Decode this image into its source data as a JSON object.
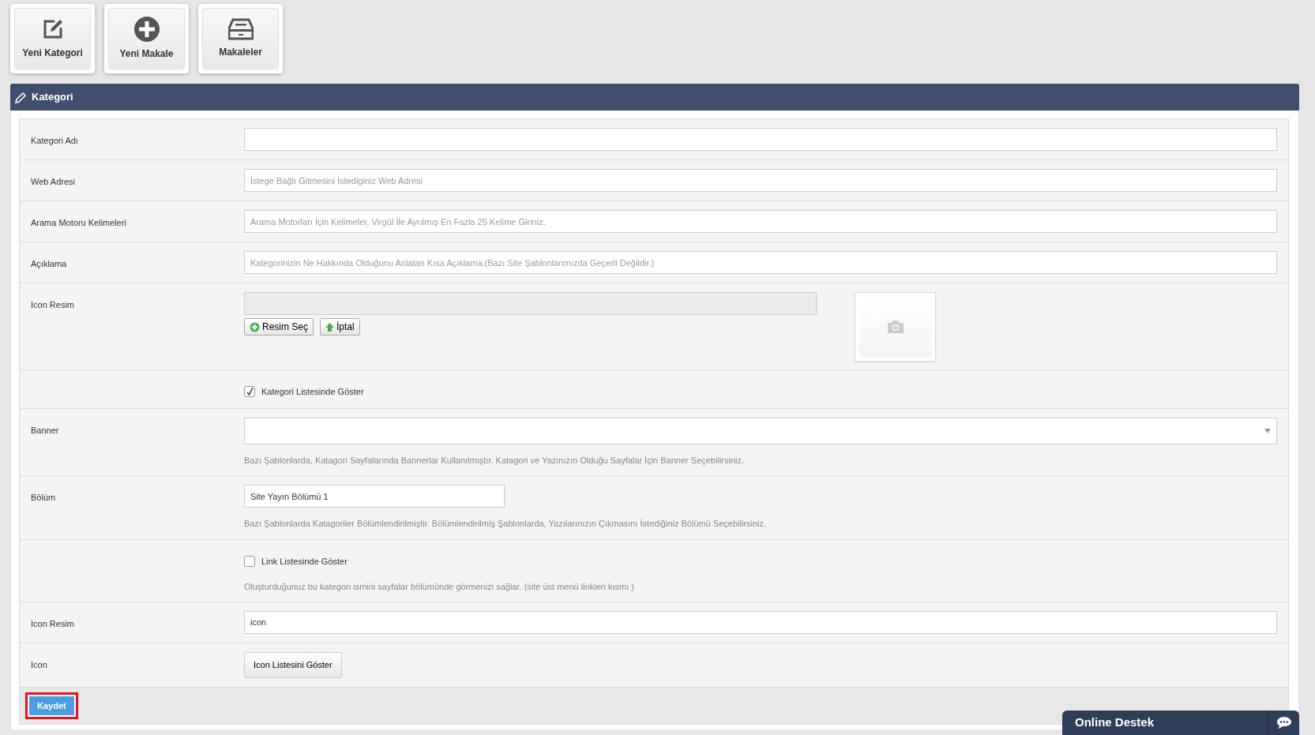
{
  "toolbar": [
    {
      "kind": "edit",
      "label": "Yeni Kategori"
    },
    {
      "kind": "plus",
      "label": "Yeni Makale"
    },
    {
      "kind": "drawer",
      "label": "Makaleler"
    }
  ],
  "panel": {
    "title": "Kategori"
  },
  "rows": [
    {
      "kind": "text",
      "label": "Kategori Adı"
    },
    {
      "kind": "text",
      "label": "Web Adresi",
      "placeholder": "İstege Bağlı Gitmesini İstediginiz Web Adresi"
    },
    {
      "kind": "text",
      "label": "Arama Motoru Kelimeleri",
      "placeholder": "Arama Motorları İçin Kelimeler, Virgül İle Ayrılmış En Fazla 25 Kelime Giriniz."
    },
    {
      "kind": "text",
      "label": "Açıklama",
      "placeholder": "Kategorinizin Ne Hakkında Olduğunu Anlatan Kısa Açıklama.(Bazı Site Şablonlarımızda Geçerli Değildir.)"
    },
    {
      "kind": "upload",
      "label": "Icon Resim",
      "buttons": [
        {
          "kind": "add",
          "label": "Resim Seç"
        },
        {
          "kind": "up",
          "label": "İptal"
        }
      ]
    },
    {
      "kind": "checkbox",
      "text": "Kategori Listesinde Göster",
      "checked": true
    },
    {
      "kind": "combo",
      "label": "Banner",
      "help": "Bazı Şablonlarda, Katagori Sayfalarında Bannerlar Kullanılmıştır. Katagori ve Yazınızın Olduğu Sayfalar İçin Banner Seçebilirsiniz."
    },
    {
      "kind": "select",
      "label": "Bölüm",
      "value": "Site Yayın Bölümü 1",
      "narrow": true,
      "help": "Bazı Şablonlarda Katagoriler Bölümlendirilmiştir. Bölümlendirilmiş Şablonlarda, Yazılarınızın Çıkmasını İstediğiniz Bölümü Seçebilirsiniz."
    },
    {
      "kind": "checkbox",
      "text": "Link Listesinde Göster",
      "checked": false,
      "help": "Oluşturduğunuz bu kategori ismini sayfalar bölümünde görmenizi sağlar. (site üst menü linkleri kısmı )"
    },
    {
      "kind": "select",
      "label": "Icon Resim",
      "value": "icon",
      "narrow": false
    },
    {
      "kind": "button",
      "label": "Icon",
      "button": "Icon Listesini Göster"
    }
  ],
  "save_button": {
    "label": "Kaydet",
    "highlighted": true
  },
  "chat": {
    "title": "Online Destek"
  }
}
